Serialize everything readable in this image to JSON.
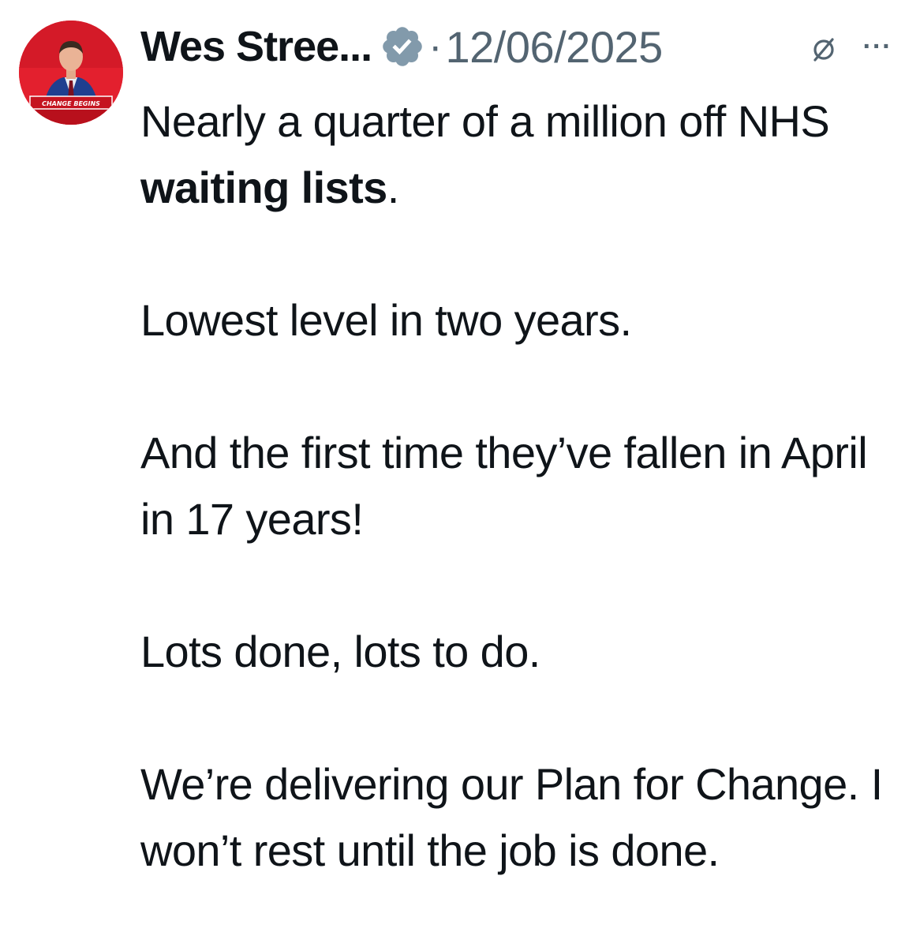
{
  "author": {
    "display_name": "Wes Stree...",
    "verified_icon": "verified-badge-icon",
    "avatar_banner_text": "CHANGE BEGINS",
    "avatar_colors": {
      "background": "#e3202e",
      "suit": "#1f3f8f"
    }
  },
  "meta": {
    "separator": "·",
    "date": "12/06/2025",
    "grok_icon": "slashed-circle-icon",
    "more_label": "···"
  },
  "post": {
    "line1_pre": "Nearly a quarter of a million off NHS ",
    "line1_highlight": "waiting lists",
    "line1_post": ".",
    "para2": "Lowest level in two years.",
    "para3": "And the first time they’ve fallen in April in 17 years!",
    "para4": "Lots done, lots to do.",
    "para5": "We’re delivering our Plan for Change. I won’t rest until the job is done."
  },
  "colors": {
    "text": "#0f1419",
    "secondary": "#536471",
    "badge": "#829aab"
  }
}
